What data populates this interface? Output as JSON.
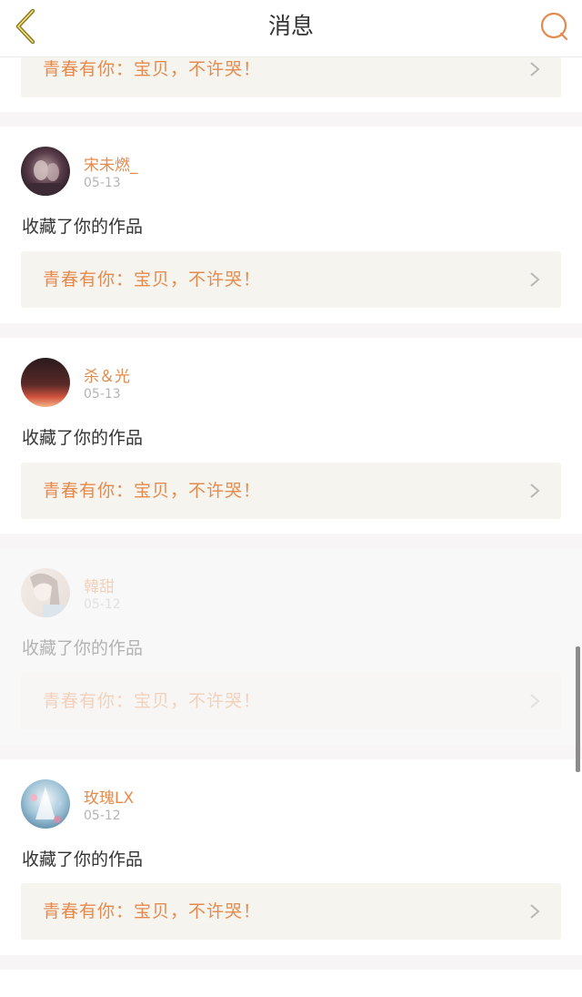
{
  "navbar": {
    "title": "消息",
    "back_icon": "chevron-left-icon",
    "search_icon": "search-icon",
    "back_color": "#8c7a20",
    "search_color": "#e58a4e"
  },
  "top_card": {
    "work_title": "青春有你：宝贝，不许哭！"
  },
  "notifications": [
    {
      "username": "宋未燃_",
      "date": "05-13",
      "action": "收藏了你的作品",
      "work_title": "青春有你：宝贝，不许哭！"
    },
    {
      "username": "杀＆光",
      "date": "05-13",
      "action": "收藏了你的作品",
      "work_title": "青春有你：宝贝，不许哭！"
    },
    {
      "username": "韓甜",
      "date": "05-12",
      "action": "收藏了你的作品",
      "work_title": "青春有你：宝贝，不许哭！"
    },
    {
      "username": "玫瑰LX",
      "date": "05-12",
      "action": "收藏了你的作品",
      "work_title": "青春有你：宝贝，不许哭！"
    }
  ],
  "colors": {
    "accent": "#e58a4e",
    "work_box_bg": "#f5f4ee",
    "date_gray": "#b5b5b5",
    "text_dark": "#333333"
  }
}
